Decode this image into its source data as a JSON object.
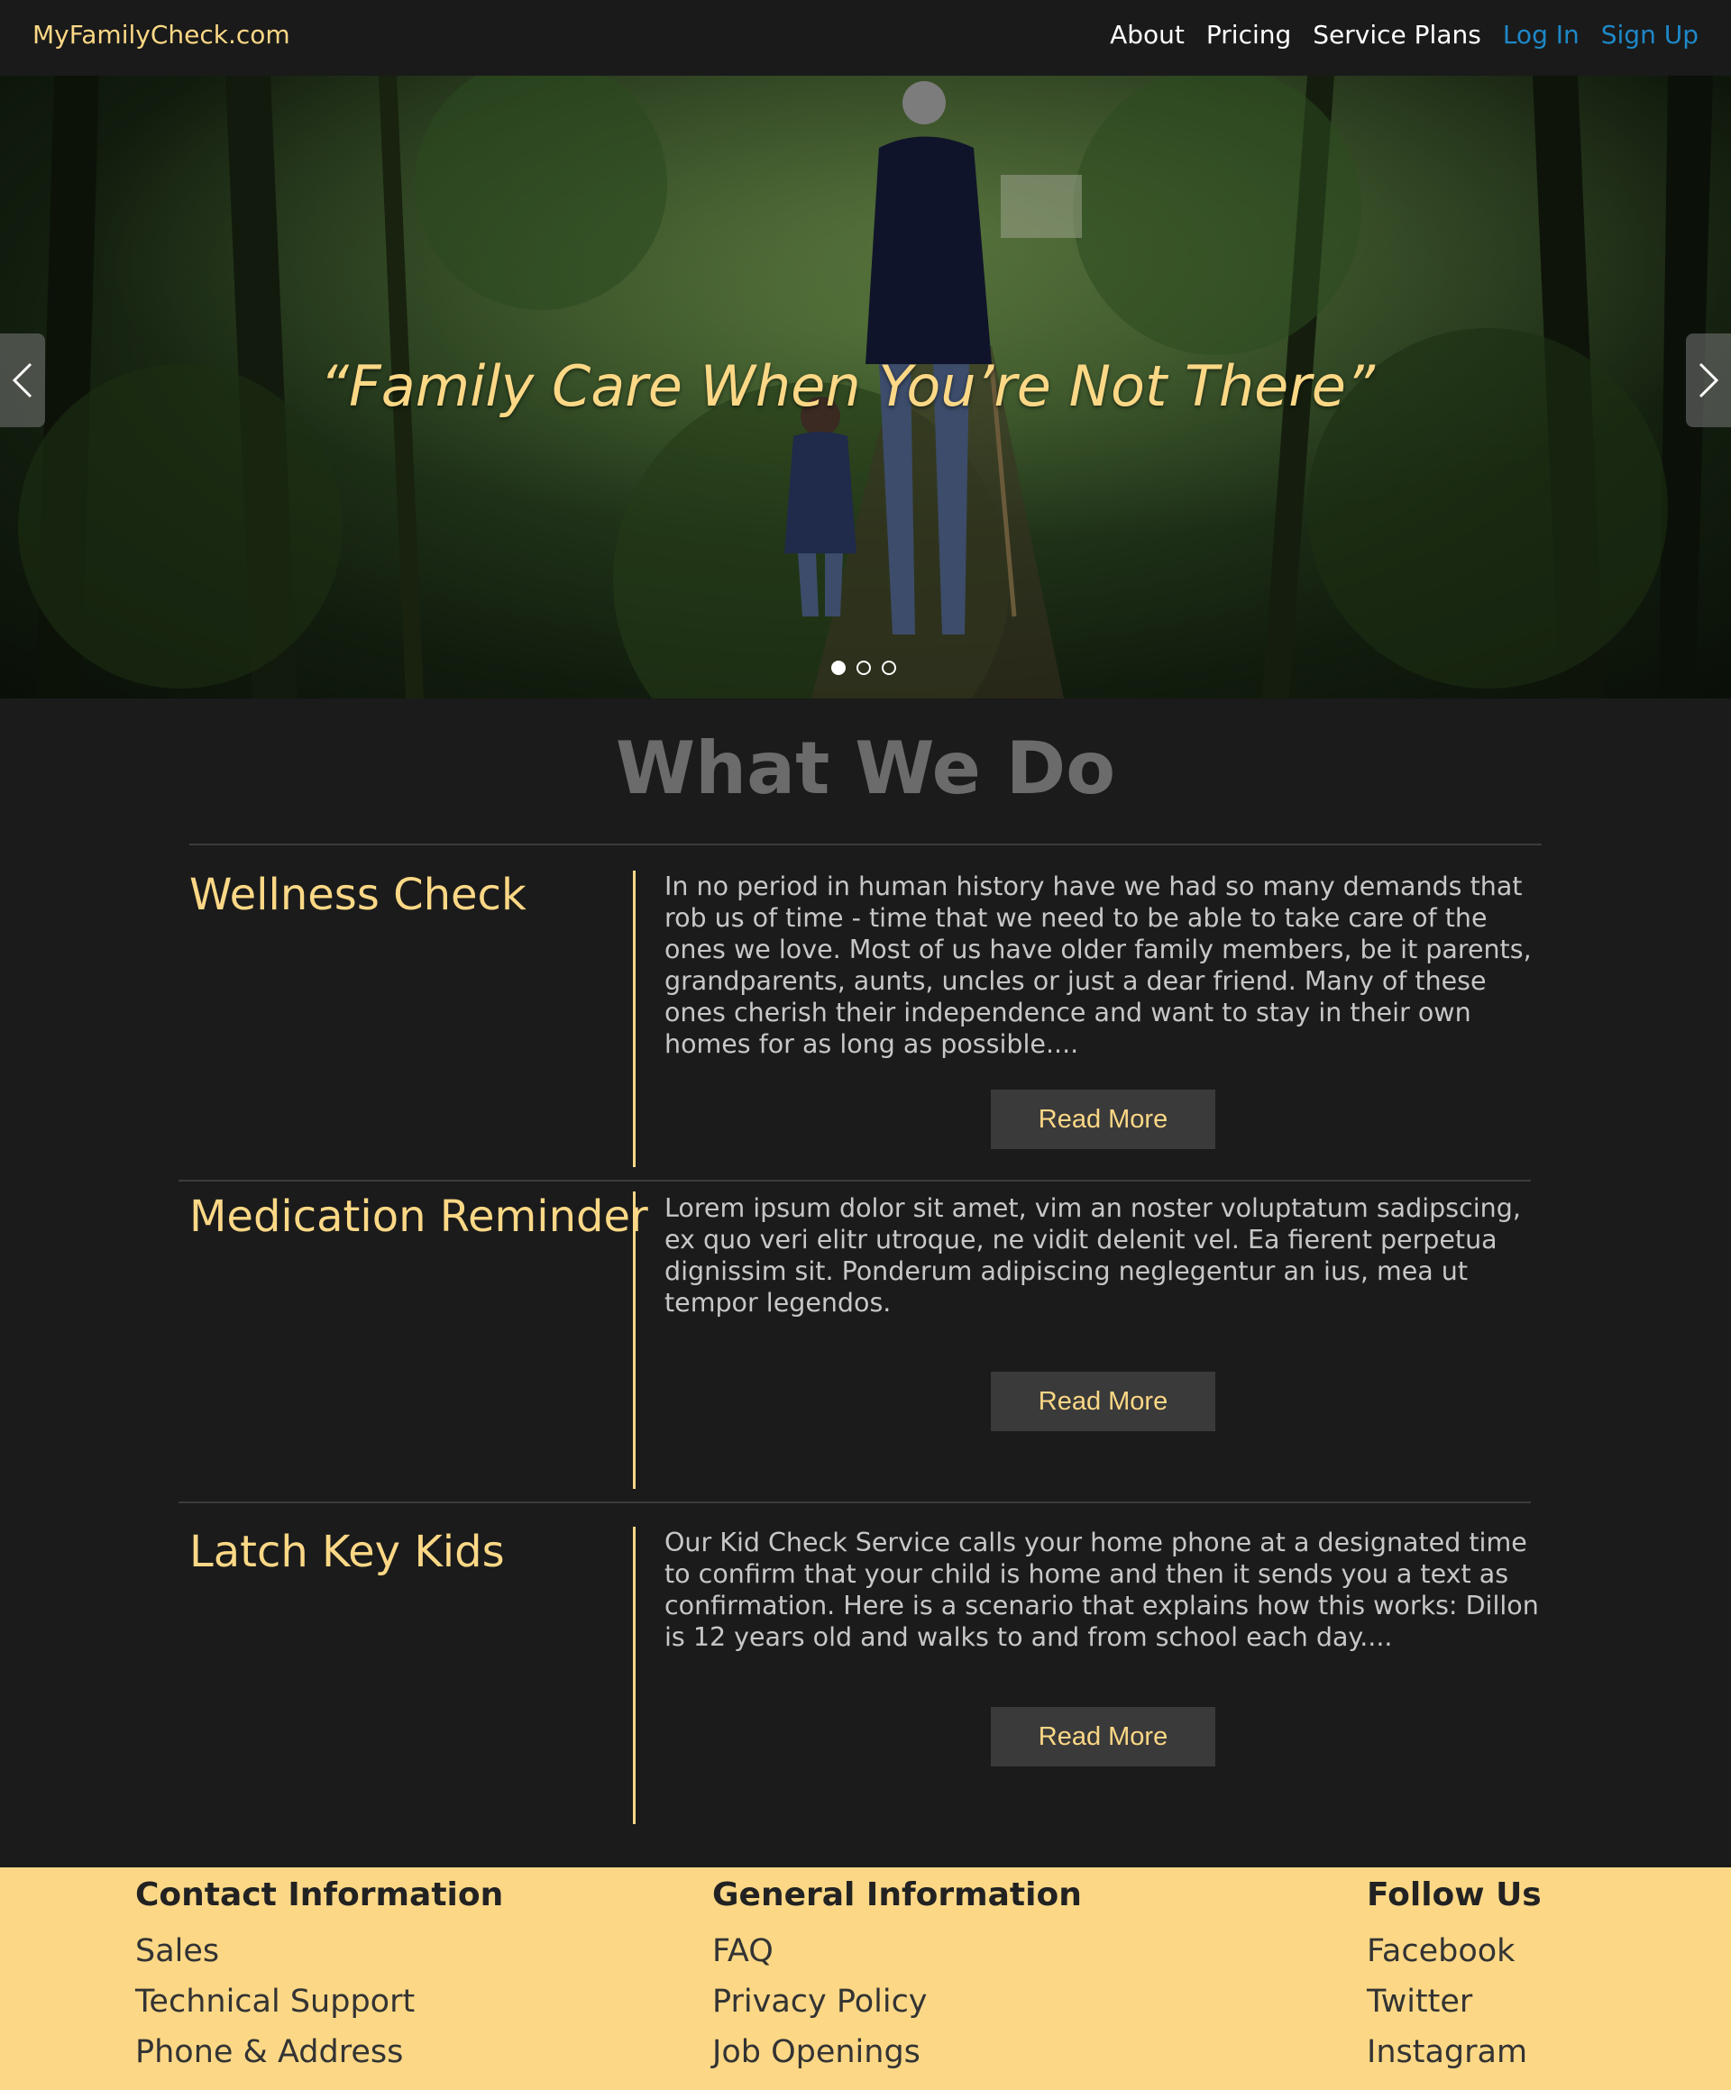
{
  "nav": {
    "brand": "MyFamilyCheck.com",
    "links": [
      "About",
      "Pricing",
      "Service Plans",
      "Log In",
      "Sign Up"
    ]
  },
  "hero": {
    "quote": "“Family Care When You’re Not There”",
    "slides_total": 3,
    "active_slide": 1
  },
  "what_we_do": {
    "title": "What We Do",
    "services": [
      {
        "title": "Wellness Check",
        "text": "In no period in human history have we had so many demands that rob us of time - time that we need to be able to take care of the ones we love. Most of us have older family members, be it parents, grandparents, aunts, uncles or just a dear friend. Many of these ones cherish their independence and want to stay in their own homes for as long as possible....",
        "button": "Read More"
      },
      {
        "title": "Medication Reminder",
        "text": "Lorem ipsum dolor sit amet, vim an noster voluptatum sadipscing, ex quo veri elitr utroque, ne vidit delenit vel. Ea fierent perpetua dignissim sit. Ponderum adipiscing neglegentur an ius, mea ut tempor legendos.",
        "button": "Read More"
      },
      {
        "title": "Latch Key Kids",
        "text": "Our Kid Check Service calls your home phone at a designated time to confirm that your child is home and then it sends you a text as confirmation. Here is a scenario that explains how this works: Dillon is 12 years old and walks to and from school each day....",
        "button": "Read More"
      }
    ]
  },
  "footer": {
    "contact": {
      "heading": "Contact Information",
      "links": [
        "Sales",
        "Technical Support",
        "Phone & Address"
      ]
    },
    "general": {
      "heading": "General Information",
      "links": [
        "FAQ",
        "Privacy Policy",
        "Job Openings"
      ]
    },
    "follow": {
      "heading": "Follow Us",
      "links": [
        "Facebook",
        "Twitter",
        "Instagram"
      ]
    }
  },
  "colors": {
    "accent": "#fcd886",
    "link_blue": "#1e88c8",
    "background": "#1b1b1b"
  }
}
